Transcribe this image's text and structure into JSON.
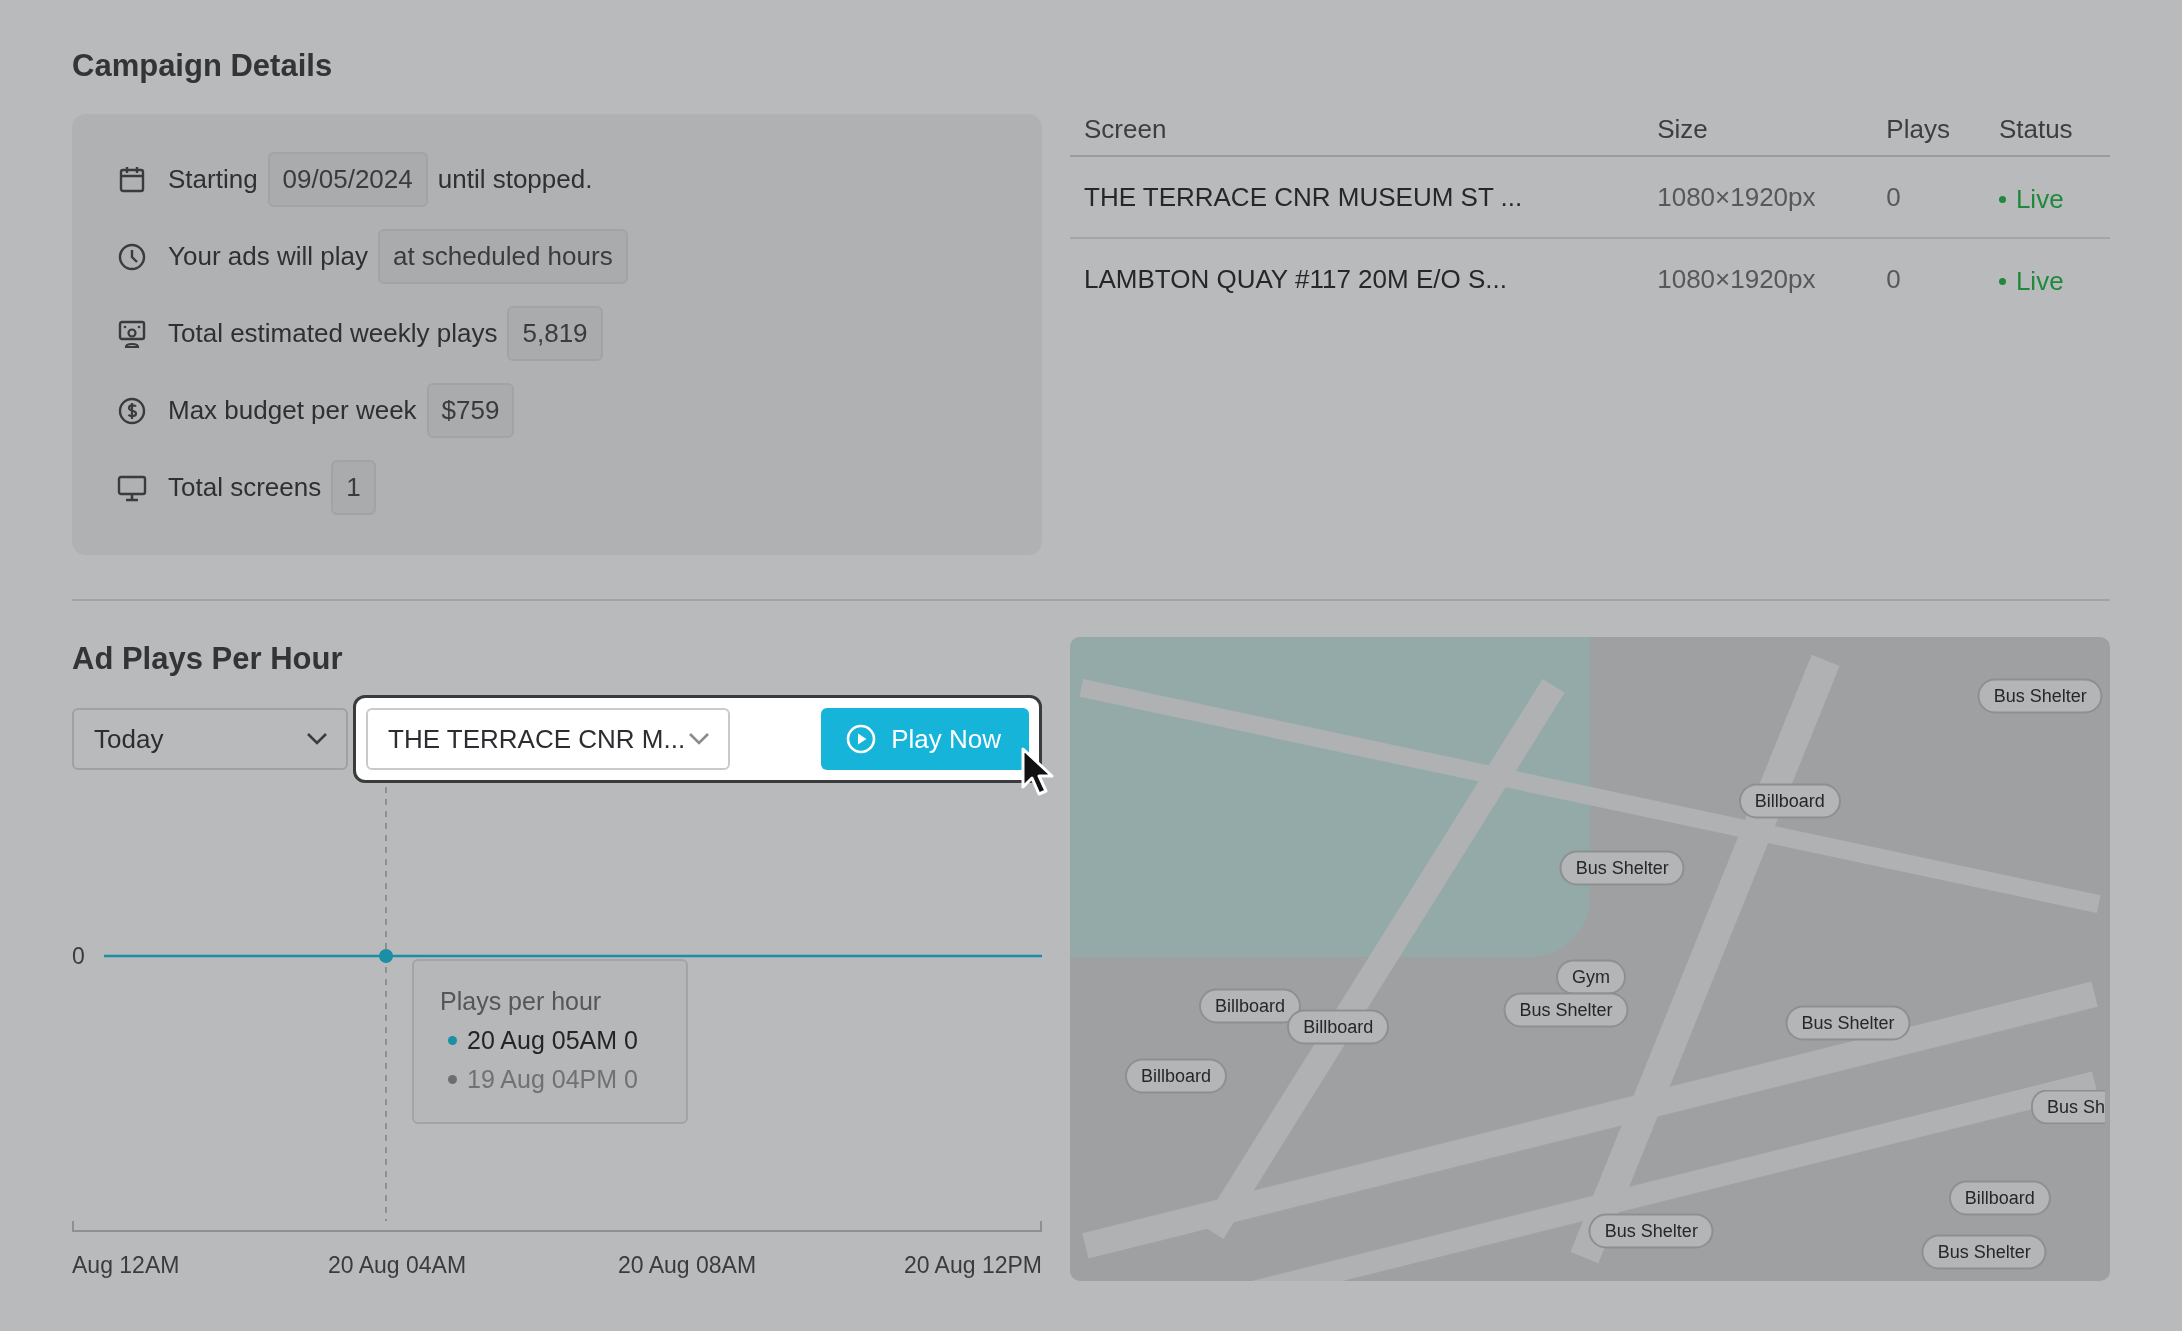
{
  "title": "Campaign Details",
  "details": [
    {
      "kind": "calendar",
      "label": "Starting",
      "value": "09/05/2024",
      "suffix": "until stopped."
    },
    {
      "kind": "clock",
      "label": "Your ads will play",
      "value": "at scheduled hours"
    },
    {
      "kind": "audience",
      "label": "Total estimated weekly plays",
      "value": "5,819"
    },
    {
      "kind": "dollar",
      "label": "Max budget per week",
      "value": "$759"
    },
    {
      "kind": "monitor",
      "label": "Total screens",
      "value": "1"
    }
  ],
  "table": {
    "columns": [
      "Screen",
      "Size",
      "Plays",
      "Status"
    ],
    "rows": [
      {
        "screen": "THE TERRACE CNR MUSEUM ST ...",
        "size": "1080×1920px",
        "plays": "0",
        "status": "Live",
        "color": "#1f8a3c"
      },
      {
        "screen": "LAMBTON QUAY #117 20M E/O S...",
        "size": "1080×1920px",
        "plays": "0",
        "status": "Live",
        "color": "#1f8a3c"
      }
    ]
  },
  "chart_section": {
    "title": "Ad Plays Per Hour",
    "period_select": {
      "value": "Today"
    },
    "screen_select": {
      "value": "THE TERRACE CNR M..."
    },
    "play_button": "Play Now",
    "chart": {
      "y_label": "0",
      "x_labels": [
        "Aug 12AM",
        "20 Aug 04AM",
        "20 Aug 08AM",
        "20 Aug 12PM"
      ]
    },
    "tooltip": {
      "title": "Plays per hour",
      "entries": [
        {
          "text": "20 Aug 05AM 0",
          "selected": true
        },
        {
          "text": "19 Aug 04PM 0",
          "selected": false
        }
      ]
    }
  },
  "map": {
    "pins": [
      "Bus Shelter",
      "Billboard",
      "Bus Shelter",
      "Gym",
      "Billboard",
      "Billboard",
      "Bus Shelter",
      "Bus Shelter",
      "Billboard",
      "Bus Sh",
      "Billboard",
      "Bus Shelter",
      "Bus Shelter"
    ]
  }
}
